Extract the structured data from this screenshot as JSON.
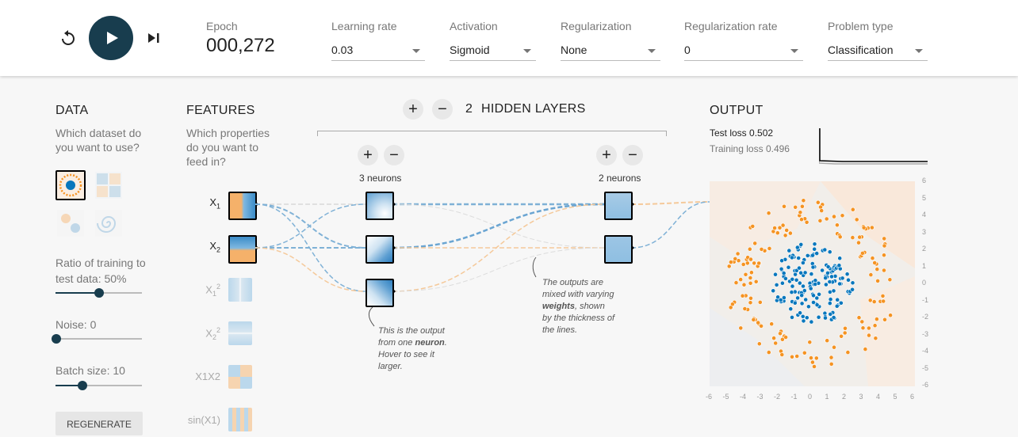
{
  "controls": {
    "reset_icon": "reset-icon",
    "play_icon": "play-icon",
    "step_icon": "step-icon"
  },
  "epoch": {
    "label": "Epoch",
    "value": "000,272"
  },
  "dropdowns": [
    {
      "label": "Learning rate",
      "value": "0.03"
    },
    {
      "label": "Activation",
      "value": "Sigmoid"
    },
    {
      "label": "Regularization",
      "value": "None"
    },
    {
      "label": "Regularization rate",
      "value": "0"
    },
    {
      "label": "Problem type",
      "value": "Classification"
    }
  ],
  "data": {
    "header": "DATA",
    "question_line1": "Which dataset do",
    "question_line2": "you want to use?",
    "ratio_line1": "Ratio of training to",
    "ratio_line2": "test data:  50%",
    "ratio_value": 0.5,
    "noise_label": "Noise:  0",
    "noise_value": 0,
    "batch_label": "Batch size:  10",
    "batch_value": 0.33,
    "regenerate": "REGENERATE"
  },
  "features": {
    "header": "FEATURES",
    "q1": "Which properties",
    "q2": "do you want to",
    "q3": "feed in?",
    "items": [
      {
        "label": "X",
        "sub": "1",
        "sup": "",
        "active": true
      },
      {
        "label": "X",
        "sub": "2",
        "sup": "",
        "active": true
      },
      {
        "label": "X",
        "sub": "1",
        "sup": "2",
        "active": false
      },
      {
        "label": "X",
        "sub": "2",
        "sup": "2",
        "active": false
      },
      {
        "label": "X1X2",
        "sub": "",
        "sup": "",
        "active": false
      },
      {
        "label": "sin(X1)",
        "sub": "",
        "sup": "",
        "active": false
      }
    ],
    "labels_text": [
      "X1",
      "X2",
      "X12",
      "X22",
      "X1X2",
      "sin(X1)"
    ]
  },
  "hidden": {
    "count": "2",
    "title": "HIDDEN LAYERS",
    "plus": "+",
    "minus": "−",
    "layer1_neurons": "3 neurons",
    "layer2_neurons": "2 neurons"
  },
  "notes": {
    "neuron_a": "This is the output",
    "neuron_b": "from one",
    "neuron_bold": "neuron",
    "neuron_c": "Hover to see it",
    "neuron_d": "larger.",
    "weights_a": "The outputs are",
    "weights_b": "mixed with varying",
    "weights_bold": "weights",
    "weights_c": ", shown",
    "weights_d": "by the thickness of",
    "weights_e": "the lines."
  },
  "output": {
    "header": "OUTPUT",
    "test_loss_label": "Test loss",
    "test_loss": "0.502",
    "training_loss_label": "Training loss",
    "training_loss": "0.496",
    "y_ticks": [
      "6",
      "5",
      "4",
      "3",
      "2",
      "1",
      "0",
      "-1",
      "-2",
      "-3",
      "-4",
      "-5",
      "-6"
    ],
    "x_ticks": [
      "-6",
      "-5",
      "-4",
      "-3",
      "-2",
      "-1",
      "0",
      "1",
      "2",
      "3",
      "4",
      "5",
      "6"
    ]
  },
  "colors": {
    "accent": "#183D4E",
    "orange": "#F59322",
    "blue": "#0877BD"
  }
}
